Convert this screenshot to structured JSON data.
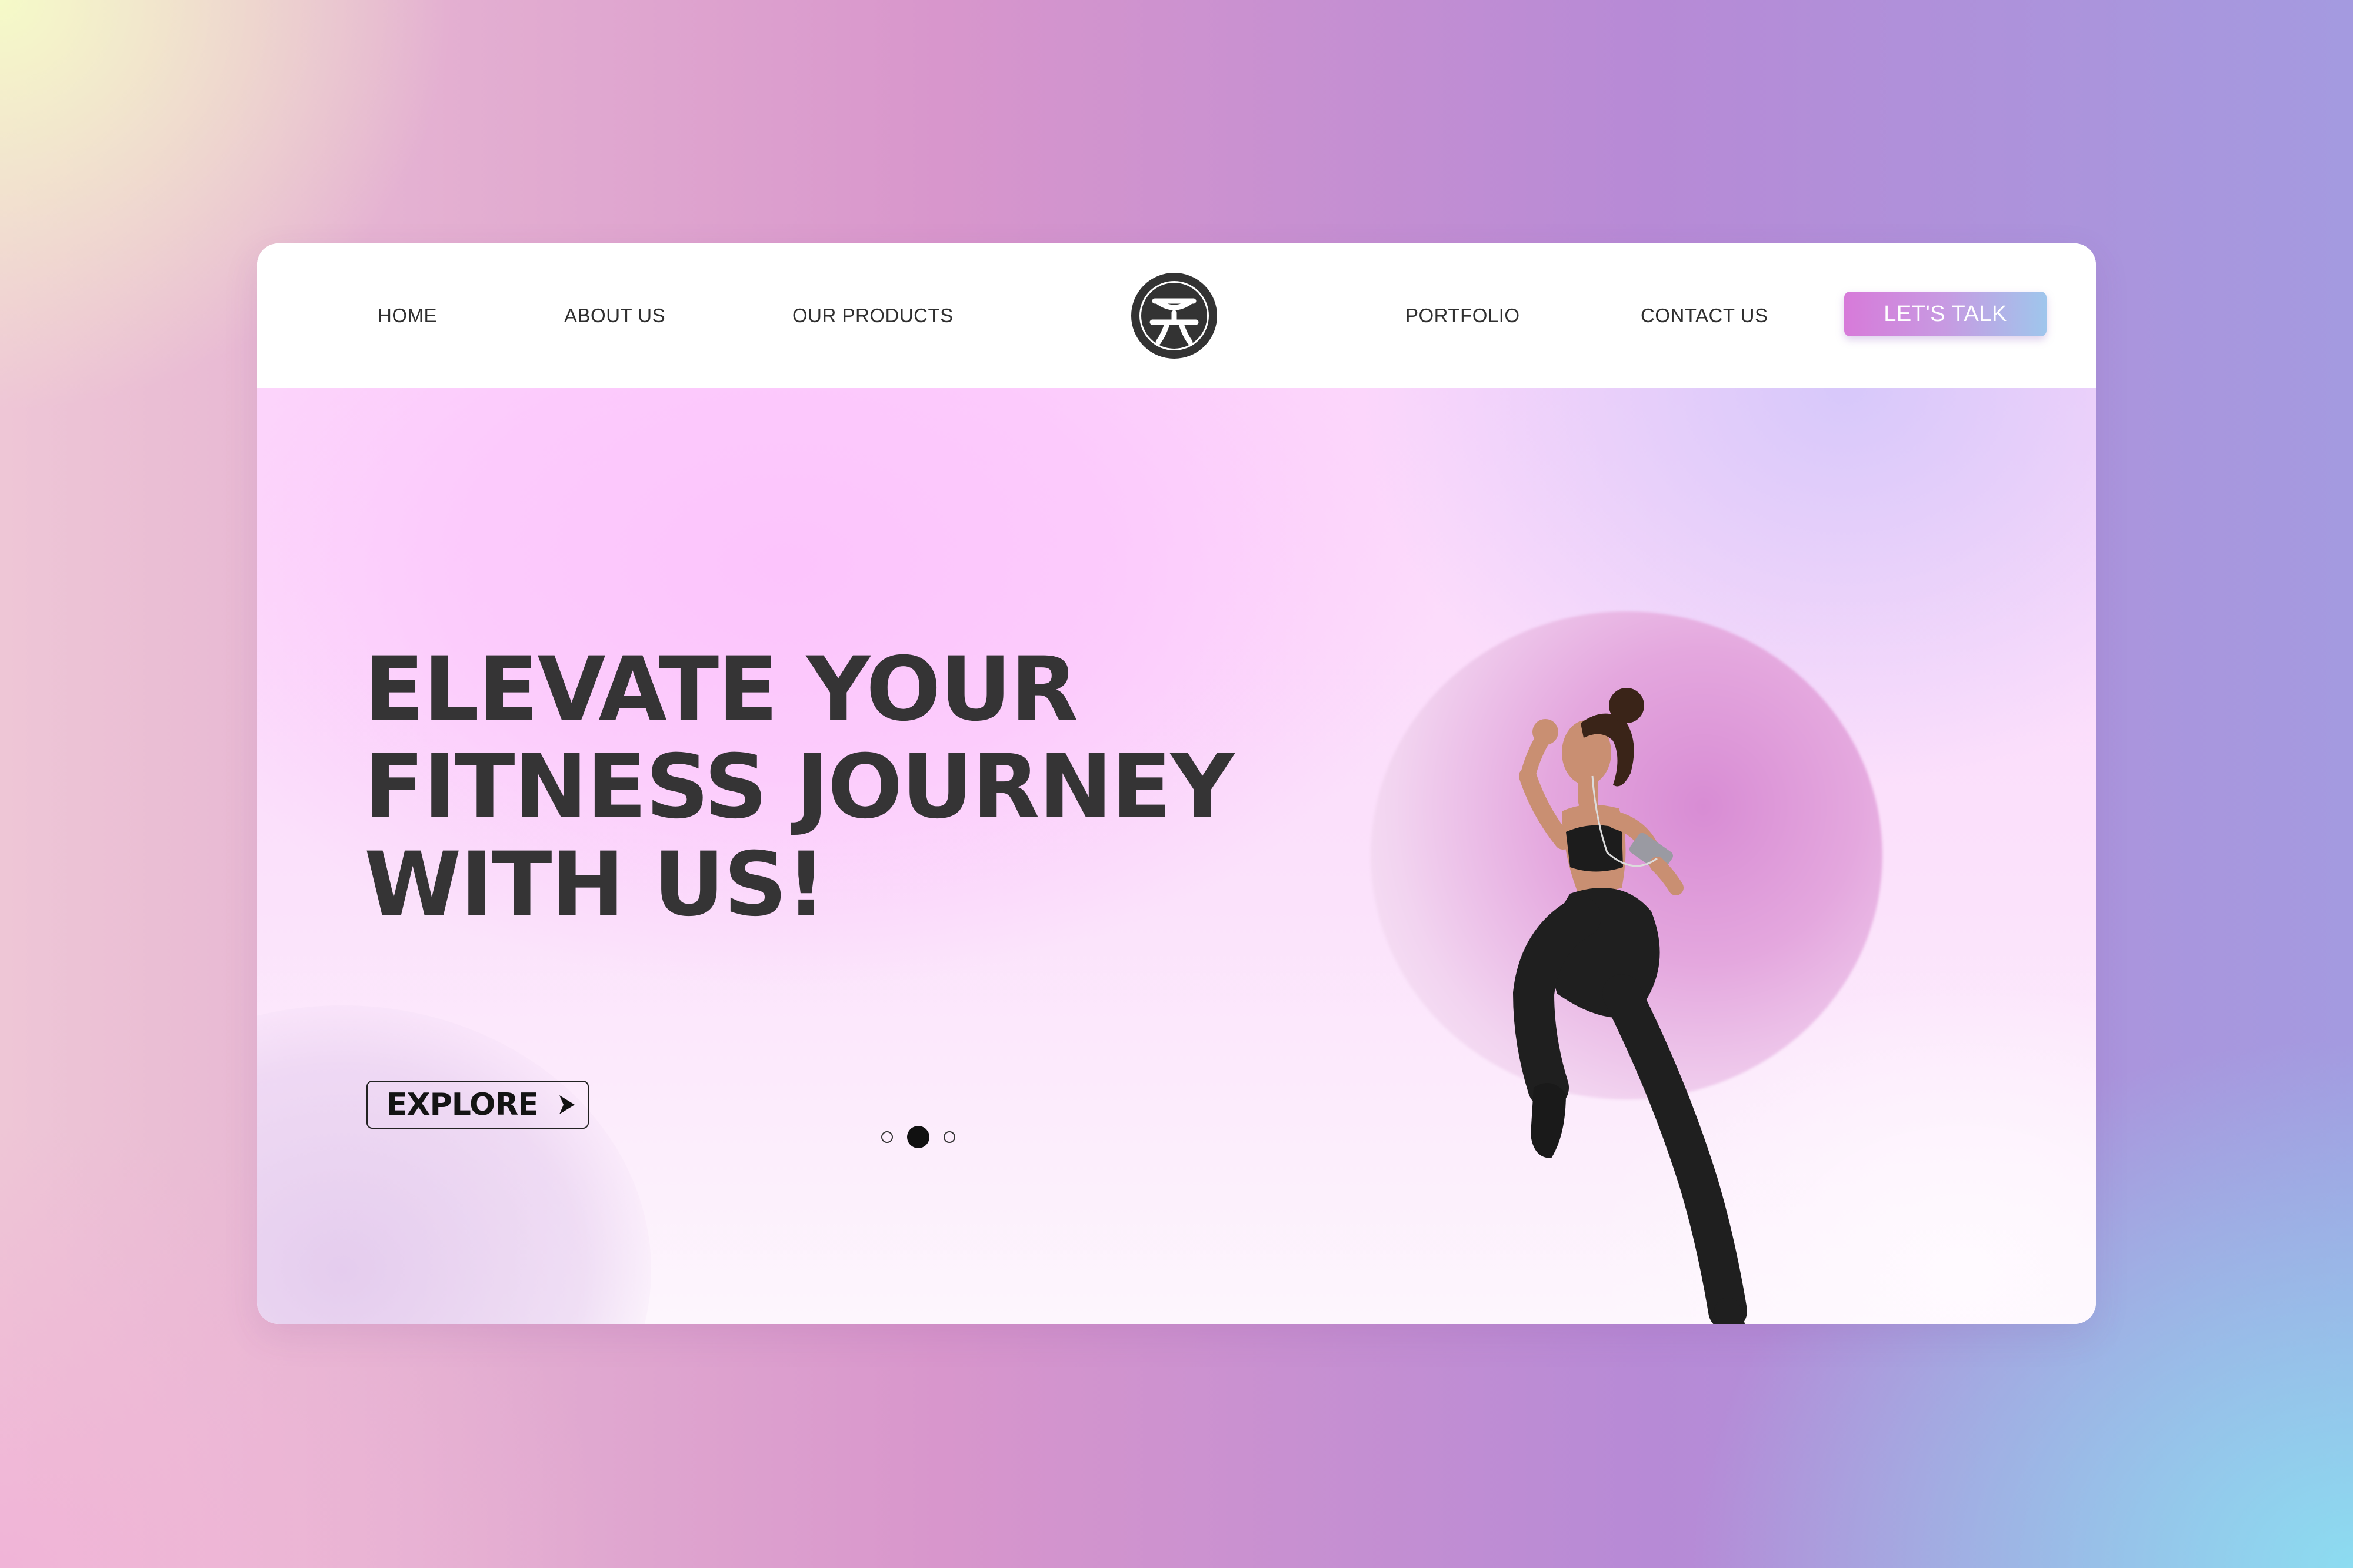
{
  "nav": {
    "items": [
      {
        "label": "HOME"
      },
      {
        "label": "ABOUT US"
      },
      {
        "label": "OUR PRODUCTS"
      },
      {
        "label": "PORTFOLIO"
      },
      {
        "label": "CONTACT US"
      }
    ],
    "logo_icon": "circle-logo-icon",
    "cta_label": "LET'S TALK"
  },
  "hero": {
    "headline_lines": [
      "ELEVATE YOUR",
      "FITNESS JOURNEY",
      "WITH US!"
    ],
    "explore_label": "EXPLORE",
    "explore_icon": "arrow-right-icon",
    "image_subject": "jumping-athlete"
  },
  "carousel": {
    "slides": 3,
    "active_index": 1
  },
  "colors": {
    "text_dark": "#353435",
    "cta_gradient_start": "#d77ad9",
    "cta_gradient_end": "#9fc6ec",
    "hero_pink": "#fcd7fb"
  }
}
